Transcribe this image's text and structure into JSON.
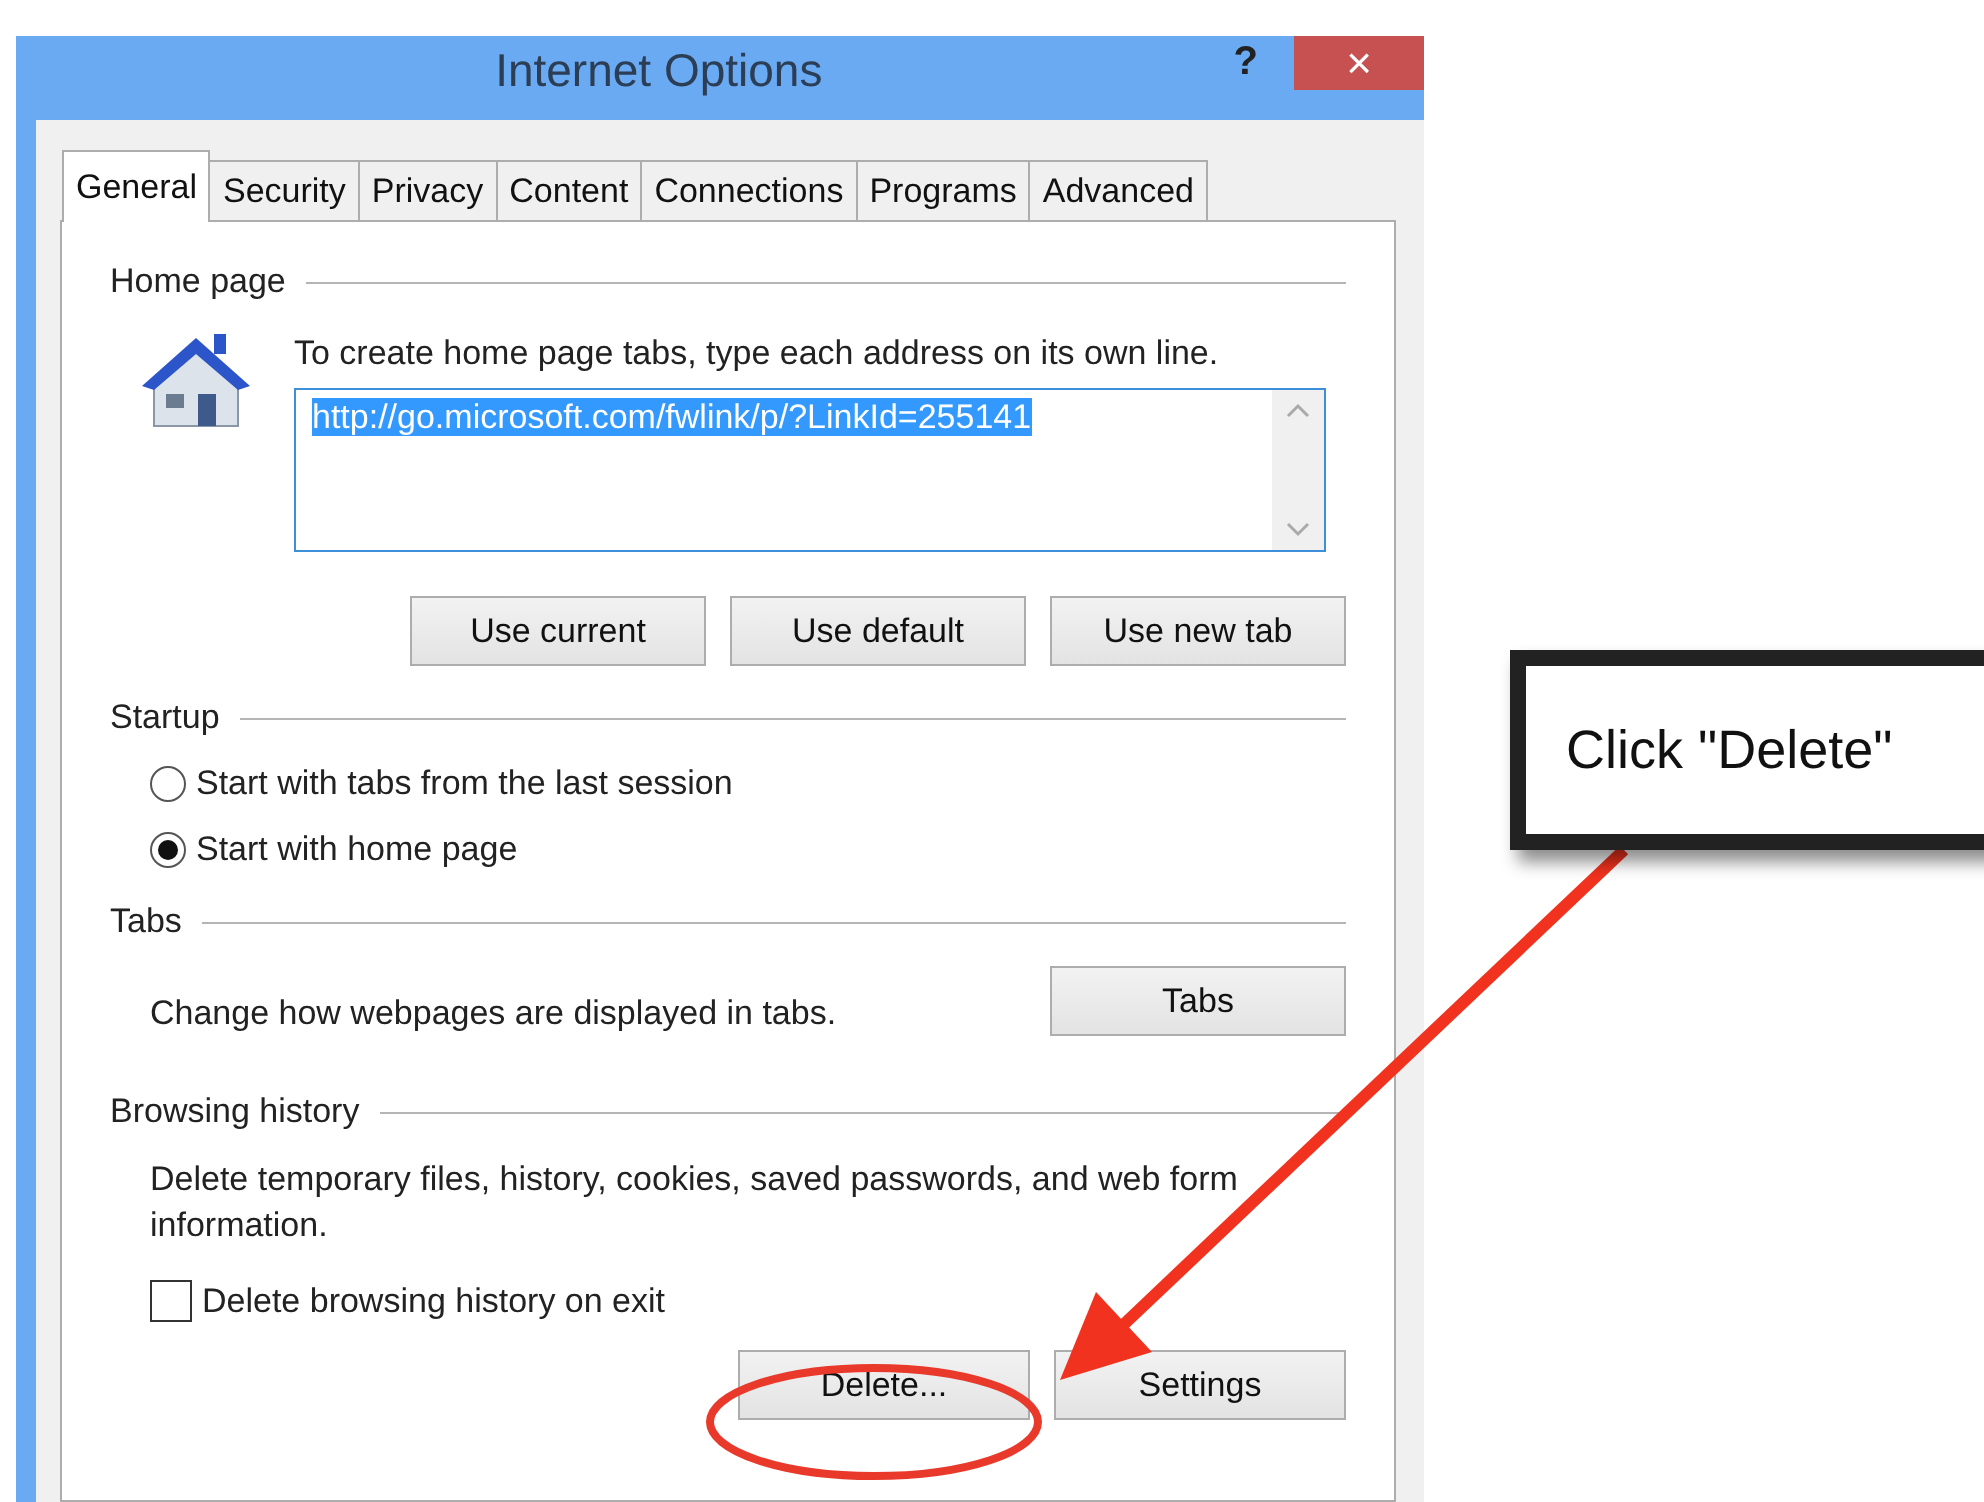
{
  "window": {
    "title": "Internet Options",
    "help": "?",
    "close": "×"
  },
  "tabs": [
    {
      "label": "General",
      "selected": true
    },
    {
      "label": "Security",
      "selected": false
    },
    {
      "label": "Privacy",
      "selected": false
    },
    {
      "label": "Content",
      "selected": false
    },
    {
      "label": "Connections",
      "selected": false
    },
    {
      "label": "Programs",
      "selected": false
    },
    {
      "label": "Advanced",
      "selected": false
    }
  ],
  "home_page": {
    "legend": "Home page",
    "instruction": "To create home page tabs, type each address on its own line.",
    "address": "http://go.microsoft.com/fwlink/p/?LinkId=255141",
    "buttons": [
      "Use current",
      "Use default",
      "Use new tab"
    ]
  },
  "startup": {
    "legend": "Startup",
    "options": [
      {
        "label": "Start with tabs from the last session",
        "selected": false
      },
      {
        "label": "Start with home page",
        "selected": true
      }
    ]
  },
  "tabs_section": {
    "legend": "Tabs",
    "description": "Change how webpages are displayed in tabs.",
    "button": "Tabs"
  },
  "browsing_history": {
    "legend": "Browsing history",
    "description": "Delete temporary files, history, cookies, saved passwords, and web form information.",
    "delete_on_exit": {
      "label": "Delete browsing history on exit",
      "checked": false
    },
    "buttons": [
      "Delete...",
      "Settings"
    ]
  },
  "callout": {
    "text": "Click \"Delete\""
  }
}
